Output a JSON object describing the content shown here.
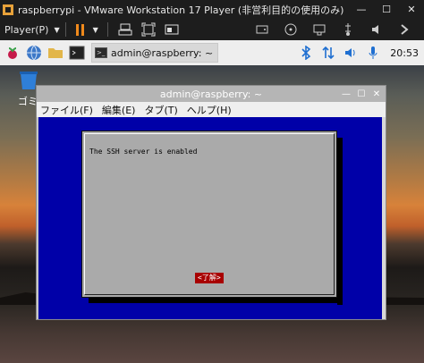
{
  "vm": {
    "title": "raspberrypi - VMware Workstation 17 Player (非営利目的の使用のみ)",
    "player_label": "Player(P)",
    "accent": "#f08a1c"
  },
  "panel": {
    "task_label": "admin@raspberry: ~",
    "clock": "20:53"
  },
  "desktop": {
    "trash_label": "ゴミ"
  },
  "terminal": {
    "title": "admin@raspberry: ~",
    "menu": [
      "ファイル(F)",
      "編集(E)",
      "タブ(T)",
      "ヘルプ(H)"
    ]
  },
  "dialog": {
    "message": "The SSH server is enabled",
    "ok_label": "<了解>",
    "bg": "#0000a8"
  }
}
